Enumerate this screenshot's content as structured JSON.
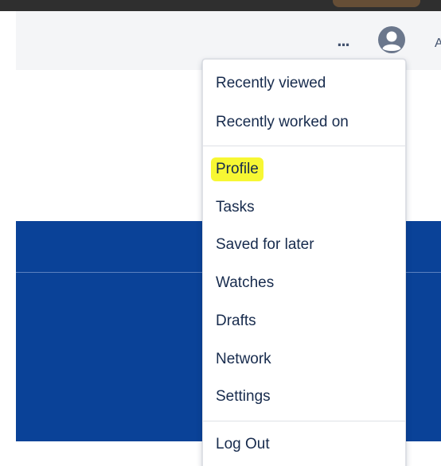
{
  "header": {
    "more_label": "...",
    "avatar_icon": "user-avatar-icon",
    "edge_glyph": "A"
  },
  "colors": {
    "banner": "#0a4298",
    "highlight": "#f7f733",
    "menu_text": "#172b4d",
    "header_bg": "#f4f5f7"
  },
  "menu": {
    "group1": [
      {
        "label": "Recently viewed"
      },
      {
        "label": "Recently worked on"
      }
    ],
    "group2": [
      {
        "label": "Profile",
        "highlighted": true
      },
      {
        "label": "Tasks"
      },
      {
        "label": "Saved for later"
      },
      {
        "label": "Watches"
      },
      {
        "label": "Drafts"
      },
      {
        "label": "Network"
      },
      {
        "label": "Settings"
      }
    ],
    "group3": [
      {
        "label": "Log Out"
      }
    ]
  }
}
